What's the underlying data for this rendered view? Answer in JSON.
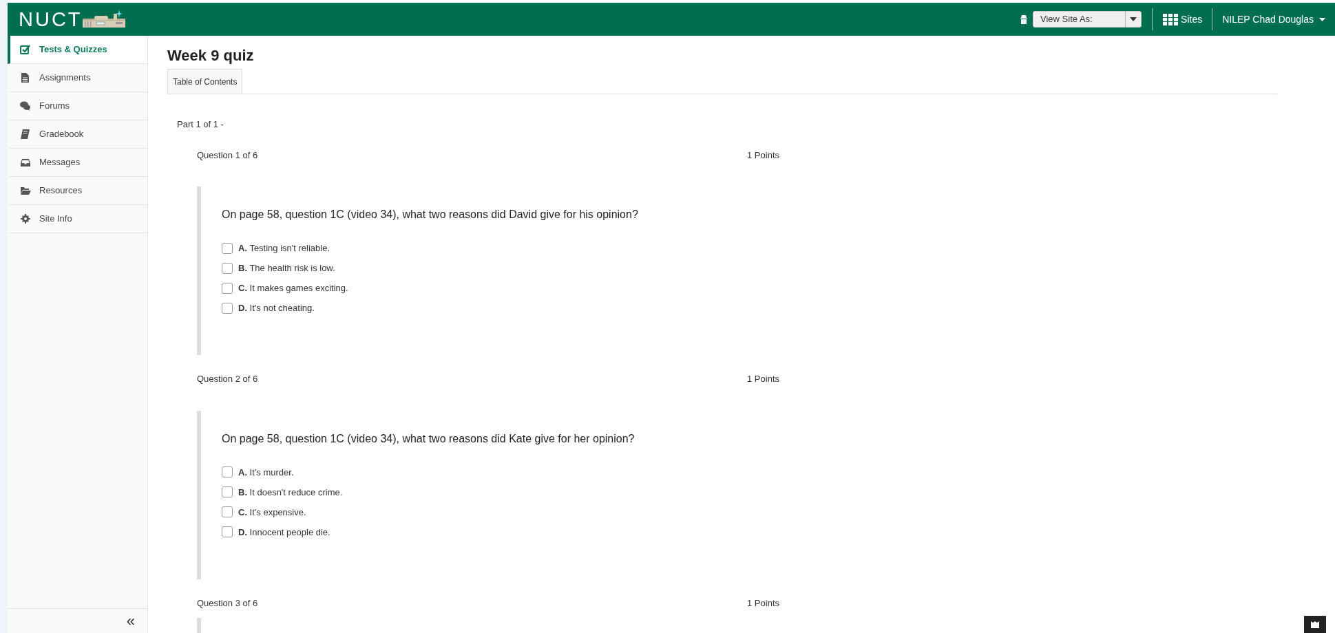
{
  "header": {
    "logo_text": "NUCT",
    "view_site_as": "View Site As:",
    "sites": "Sites",
    "user": "NILEP Chad Douglas"
  },
  "sidebar": {
    "items": [
      {
        "label": "Tests & Quizzes",
        "kind": "check",
        "selected": true
      },
      {
        "label": "Assignments",
        "kind": "file",
        "selected": false
      },
      {
        "label": "Forums",
        "kind": "comments",
        "selected": false
      },
      {
        "label": "Gradebook",
        "kind": "book",
        "selected": false
      },
      {
        "label": "Messages",
        "kind": "inbox",
        "selected": false
      },
      {
        "label": "Resources",
        "kind": "folder",
        "selected": false
      },
      {
        "label": "Site Info",
        "kind": "gear",
        "selected": false
      }
    ],
    "collapse": "«"
  },
  "page": {
    "title": "Week 9 quiz",
    "tabs": [
      {
        "label": "Table of Contents"
      }
    ],
    "part": "Part 1 of 1 -"
  },
  "questions": [
    {
      "number": "Question 1 of 6",
      "points": "1 Points",
      "text": "On page 58, question 1C (video 34), what two reasons did David give for his opinion?",
      "options": [
        {
          "letter": "A.",
          "text": "Testing isn't reliable.",
          "checked": false
        },
        {
          "letter": "B.",
          "text": "The health risk is low.",
          "checked": false
        },
        {
          "letter": "C.",
          "text": "It makes games exciting.",
          "checked": false
        },
        {
          "letter": "D.",
          "text": "It's not cheating.",
          "checked": false
        }
      ]
    },
    {
      "number": "Question 2 of 6",
      "points": "1 Points",
      "text": "On page 58, question 1C (video 34), what two reasons did Kate give for her opinion?",
      "options": [
        {
          "letter": "A.",
          "text": "It's murder.",
          "checked": false
        },
        {
          "letter": "B.",
          "text": "It doesn't reduce crime.",
          "checked": false
        },
        {
          "letter": "C.",
          "text": "It's expensive.",
          "checked": false
        },
        {
          "letter": "D.",
          "text": "Innocent people die.",
          "checked": false
        }
      ]
    },
    {
      "number": "Question 3 of 6",
      "points": "1 Points"
    }
  ]
}
